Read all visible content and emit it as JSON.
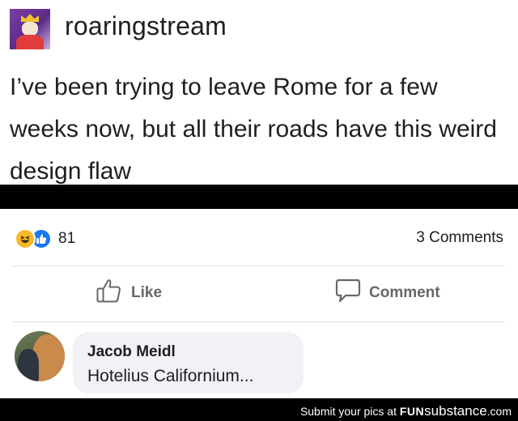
{
  "tumblr": {
    "username": "roaringstream",
    "post_text": "I’ve been trying to leave Rome for a few weeks now, but all their roads have this weird design flaw"
  },
  "facebook": {
    "reactions": {
      "icons": [
        "haha-emoji-icon",
        "like-thumb-icon"
      ],
      "count": "81"
    },
    "comments_count": "3 Comments",
    "actions": {
      "like_label": "Like",
      "comment_label": "Comment"
    },
    "comment": {
      "author": "Jacob Meidl",
      "text": "Hotelius Californium..."
    }
  },
  "footer": {
    "prefix": "Submit your pics at ",
    "brand_bold": "FUN",
    "brand_rest": "substance",
    "suffix": ".com"
  },
  "colors": {
    "like_blue": "#1877f2",
    "haha_yellow": "#f7b928",
    "action_gray": "#65676b",
    "bubble_bg": "#f0f2f5"
  }
}
